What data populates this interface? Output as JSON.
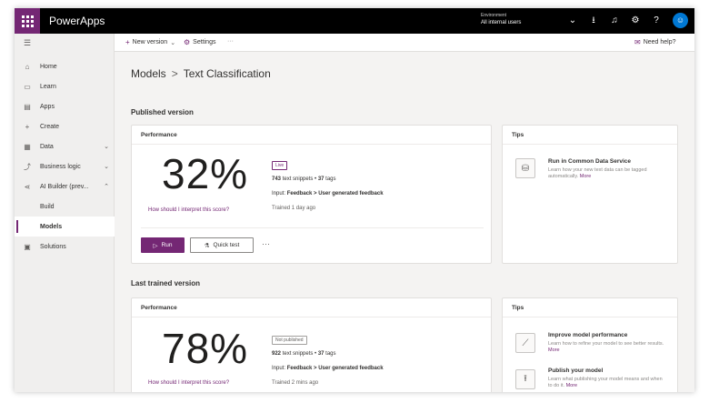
{
  "app": {
    "title": "PowerApps"
  },
  "topbar": {
    "environment_label": "Environment",
    "environment_value": "All internal users",
    "icons": [
      "chevron-down-icon",
      "download-icon",
      "bell-icon",
      "gear-icon",
      "help-icon"
    ],
    "chevron_glyph": "⌄",
    "download_glyph": "⭳",
    "bell_glyph": "♫",
    "gear_glyph": "⚙",
    "help_glyph": "?",
    "avatar_initial": "☺"
  },
  "commandbar": {
    "new_version_label": "New version",
    "settings_label": "Settings",
    "more_label": "···",
    "need_help_label": "Need help?"
  },
  "sidebar": {
    "items": [
      {
        "label": "Home",
        "icon": "home-icon"
      },
      {
        "label": "Learn",
        "icon": "book-icon"
      },
      {
        "label": "Apps",
        "icon": "apps-icon"
      },
      {
        "label": "Create",
        "icon": "plus-icon"
      },
      {
        "label": "Data",
        "icon": "database-icon"
      },
      {
        "label": "Business logic",
        "icon": "flow-icon"
      },
      {
        "label": "AI Builder (prev...",
        "icon": "ai-icon"
      },
      {
        "label": "Build"
      },
      {
        "label": "Models"
      },
      {
        "label": "Solutions",
        "icon": "solutions-icon"
      }
    ]
  },
  "breadcrumb": {
    "root": "Models",
    "separator": ">",
    "current": "Text Classification"
  },
  "published": {
    "section_title": "Published version",
    "card_title": "Performance",
    "score": "32%",
    "interpret_link": "How should I interpret this score?",
    "badge": "Live",
    "snippets_count": "743",
    "snippets_text": "text snippets •",
    "tags_count": "37",
    "tags_text": "tags",
    "input_label": "Input:",
    "input_value": "Feedback > User generated feedback",
    "trained": "Trained 1 day ago",
    "run_label": "Run",
    "quick_test_label": "Quick test",
    "more_label": "···"
  },
  "tips1": {
    "title": "Tips",
    "items": [
      {
        "title": "Run in Common Data Service",
        "desc": "Learn how your new text data can be tagged automatically.",
        "link": "More"
      }
    ]
  },
  "last_trained": {
    "section_title": "Last trained version",
    "card_title": "Performance",
    "score": "78%",
    "interpret_link": "How should I interpret this score?",
    "badge": "Not published",
    "snippets_count": "922",
    "snippets_text": "text snippets •",
    "tags_count": "37",
    "tags_text": "tags",
    "input_label": "Input:",
    "input_value": "Feedback > User generated feedback",
    "trained": "Trained 2 mins ago"
  },
  "tips2": {
    "title": "Tips",
    "items": [
      {
        "title": "Improve model performance",
        "desc": "Learn how to refine your model to see better results.",
        "link": "More"
      },
      {
        "title": "Publish your model",
        "desc": "Learn what publishing your model means and when to do it.",
        "link": "More"
      }
    ]
  },
  "colors": {
    "brand": "#742774",
    "topbar": "#000000",
    "avatar": "#0078d4"
  }
}
